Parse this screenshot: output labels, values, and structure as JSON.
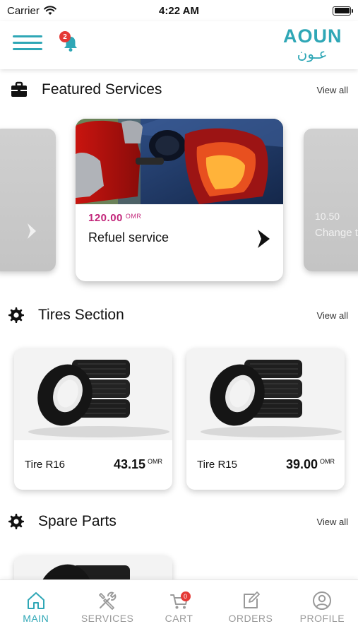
{
  "status_bar": {
    "carrier": "Carrier",
    "time": "4:22 AM"
  },
  "header": {
    "notification_count": "2",
    "logo_text": "AOUN",
    "logo_arabic": "عـون"
  },
  "featured": {
    "title": "Featured Services",
    "view_all": "View all",
    "main_card": {
      "price": "120.00",
      "currency": "OMR",
      "name": "Refuel service"
    },
    "right_card": {
      "price": "10.50",
      "name": "Change t"
    }
  },
  "tires": {
    "title": "Tires Section",
    "view_all": "View all",
    "items": [
      {
        "name": "Tire R16",
        "price": "43.15",
        "currency": "OMR"
      },
      {
        "name": "Tire R15",
        "price": "39.00",
        "currency": "OMR"
      }
    ]
  },
  "spare_parts": {
    "title": "Spare Parts",
    "view_all": "View all"
  },
  "nav": {
    "items": [
      {
        "label": "MAIN"
      },
      {
        "label": "SERVICES"
      },
      {
        "label": "CART"
      },
      {
        "label": "ORDERS"
      },
      {
        "label": "PROFILE"
      }
    ],
    "cart_count": "0"
  },
  "colors": {
    "accent": "#2fa7b6",
    "price": "#c2267a",
    "badge": "#e53935",
    "inactive": "#999999"
  },
  "icons": [
    "wifi-icon",
    "battery-icon",
    "menu-icon",
    "bell-icon",
    "briefcase-icon",
    "gear-icon",
    "chevron-right-icon",
    "home-icon",
    "tools-icon",
    "cart-icon",
    "edit-icon",
    "profile-icon"
  ]
}
